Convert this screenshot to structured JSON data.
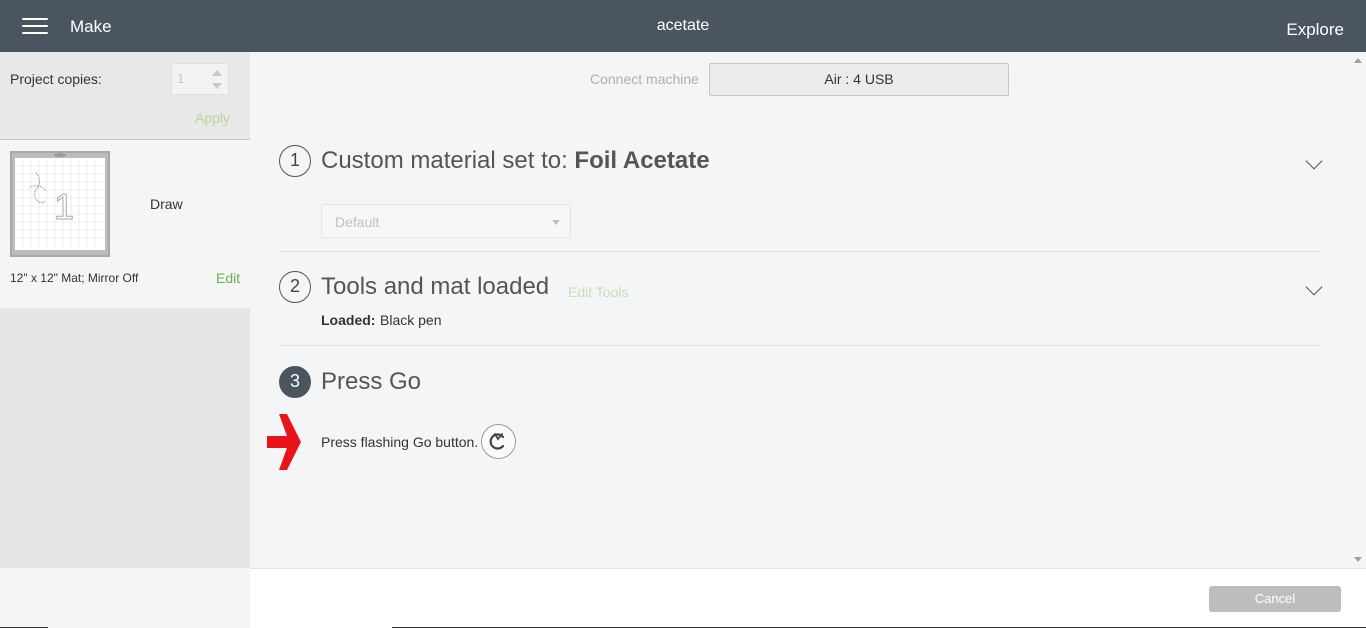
{
  "header": {
    "app_name": "Make",
    "title": "acetate",
    "explore": "Explore",
    "menu_icon": "hamburger-menu-icon"
  },
  "sidebar": {
    "copies_label": "Project copies:",
    "copies_value": "1",
    "apply_label": "Apply",
    "mat": {
      "mode": "Draw",
      "description": "12\" x 12\" Mat; Mirror Off",
      "edit_label": "Edit",
      "preview_number": "1"
    }
  },
  "connect": {
    "label": "Connect machine",
    "value": "Air : 4 USB"
  },
  "steps": {
    "step1": {
      "number": "1",
      "title_prefix": "Custom material set to: ",
      "title_bold": "Foil Acetate",
      "select_value": "Default"
    },
    "step2": {
      "number": "2",
      "title": "Tools and mat loaded",
      "edit_tools": "Edit Tools",
      "loaded_label": "Loaded:",
      "loaded_value": "Black pen"
    },
    "step3": {
      "number": "3",
      "title": "Press Go",
      "instruction": "Press flashing Go button."
    }
  },
  "footer": {
    "cancel_label": "Cancel"
  },
  "colors": {
    "header_bg": "#4b555f",
    "accent_green": "#6bb244",
    "arrow_red": "#e8141a",
    "cancel_bg": "#bdbdbd"
  }
}
